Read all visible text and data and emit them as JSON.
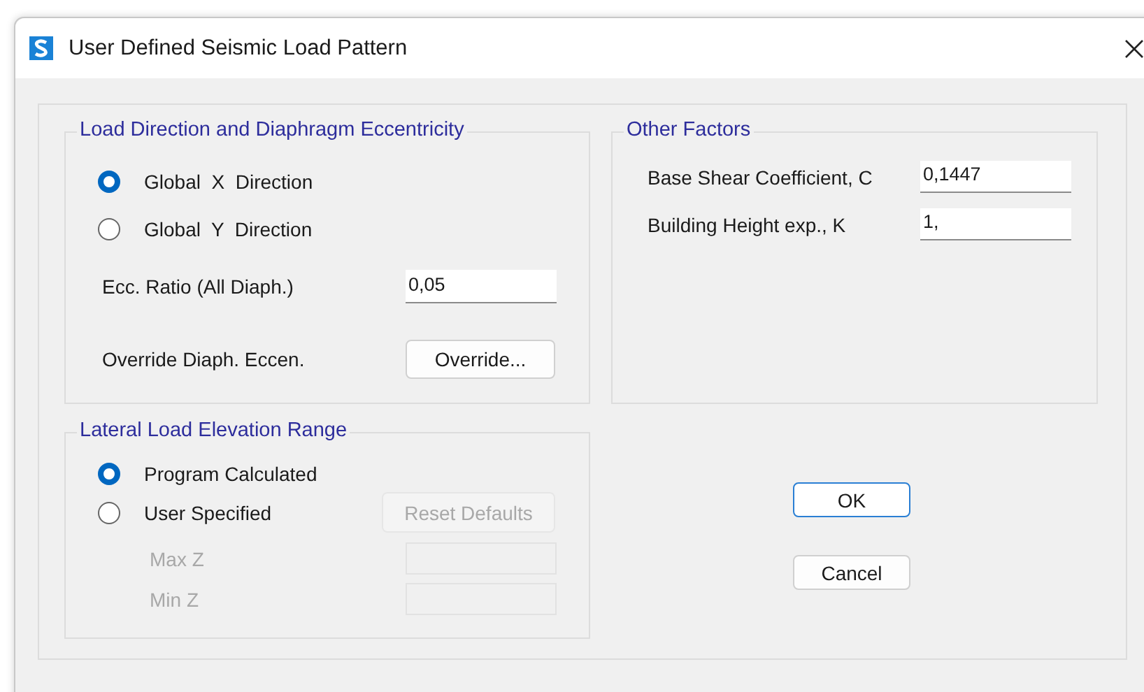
{
  "window": {
    "title": "User Defined Seismic Load Pattern"
  },
  "load_direction": {
    "title": "Load Direction and Diaphragm Eccentricity",
    "options": [
      {
        "label": "Global  X  Direction",
        "selected": true
      },
      {
        "label": "Global  Y  Direction",
        "selected": false
      }
    ],
    "ecc_ratio": {
      "label": "Ecc. Ratio (All Diaph.)",
      "value": "0,05"
    },
    "override": {
      "label": "Override Diaph. Eccen.",
      "button": "Override..."
    }
  },
  "other_factors": {
    "title": "Other Factors",
    "fields": [
      {
        "label": "Base Shear Coefficient, C",
        "value": "0,1447"
      },
      {
        "label": "Building Height exp., K",
        "value": "1,"
      }
    ]
  },
  "elevation_range": {
    "title": "Lateral Load Elevation Range",
    "options": [
      {
        "label": "Program Calculated",
        "selected": true
      },
      {
        "label": "User Specified",
        "selected": false
      }
    ],
    "reset_button": {
      "label": "Reset Defaults",
      "disabled": true
    },
    "fields": [
      {
        "label": "Max Z",
        "disabled": true
      },
      {
        "label": "Min Z",
        "disabled": true
      }
    ]
  },
  "buttons": [
    {
      "label": "OK",
      "default": true
    },
    {
      "label": "Cancel",
      "default": false
    }
  ]
}
